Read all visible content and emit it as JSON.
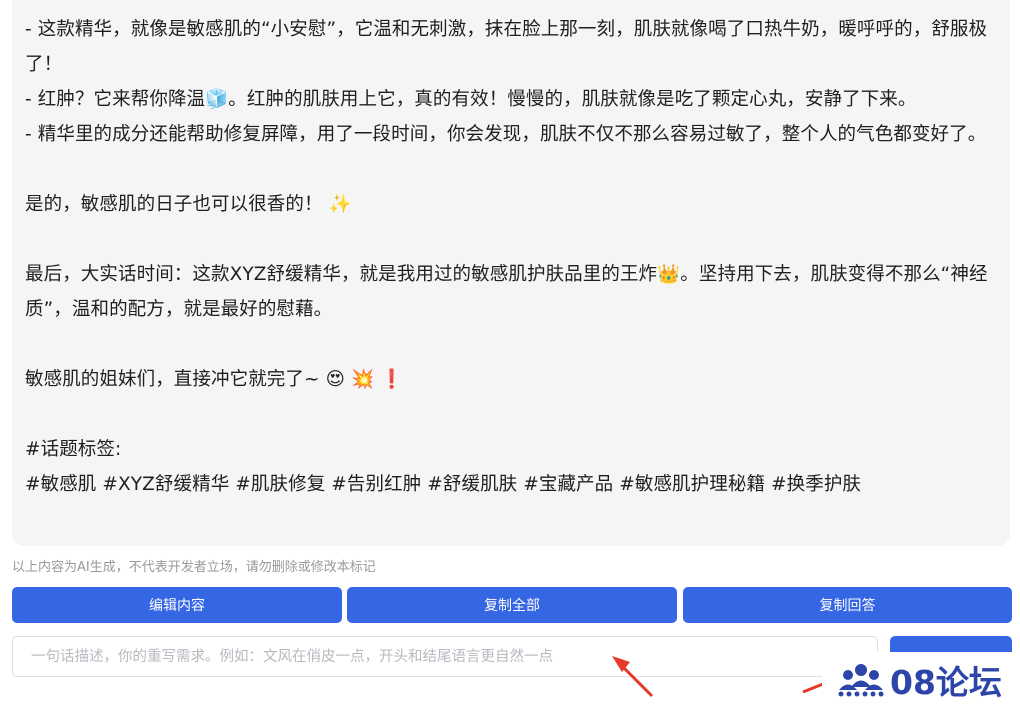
{
  "article": {
    "line1": "- 这款精华，就像是敏感肌的“小安慰”，它温和无刺激，抹在脸上那一刻，肌肤就像喝了口热牛奶，暖呼呼的，舒服极了！",
    "line2": "- 红肿？它来帮你降温🧊。红肿的肌肤用上它，真的有效！慢慢的，肌肤就像是吃了颗定心丸，安静了下来。",
    "line3": "- 精华里的成分还能帮助修复屏障，用了一段时间，你会发现，肌肤不仅不那么容易过敏了，整个人的气色都变好了。",
    "line4": "是的，敏感肌的日子也可以很香的！ ✨",
    "line5": "最后，大实话时间：这款XYZ舒缓精华，就是我用过的敏感肌护肤品里的王炸👑。坚持用下去，肌肤变得不那么“神经质”，温和的配方，就是最好的慰藉。",
    "line6": "敏感肌的姐妹们，直接冲它就完了~ 😍 💥 ❗",
    "tags_heading": "#话题标签:",
    "tags": "#敏感肌 #XYZ舒缓精华 #肌肤修复 #告别红肿 #舒缓肌肤 #宝藏产品 #敏感肌护理秘籍 #换季护肤"
  },
  "disclaimer": "以上内容为AI生成，不代表开发者立场，请勿删除或修改本标记",
  "buttons": {
    "edit": "编辑内容",
    "copy_all": "复制全部",
    "copy_answer": "复制回答"
  },
  "rewrite_input": {
    "value": "",
    "placeholder": "一句话描述，你的重写需求。例如：文风在俏皮一点，开头和结尾语言更自然一点"
  },
  "watermark": {
    "text": "08论坛",
    "icon": "people-group-icon",
    "color": "#2c45a8"
  },
  "colors": {
    "accent": "#3566e3",
    "card_bg": "#f5f5f6",
    "arrow": "#e53a2a"
  }
}
